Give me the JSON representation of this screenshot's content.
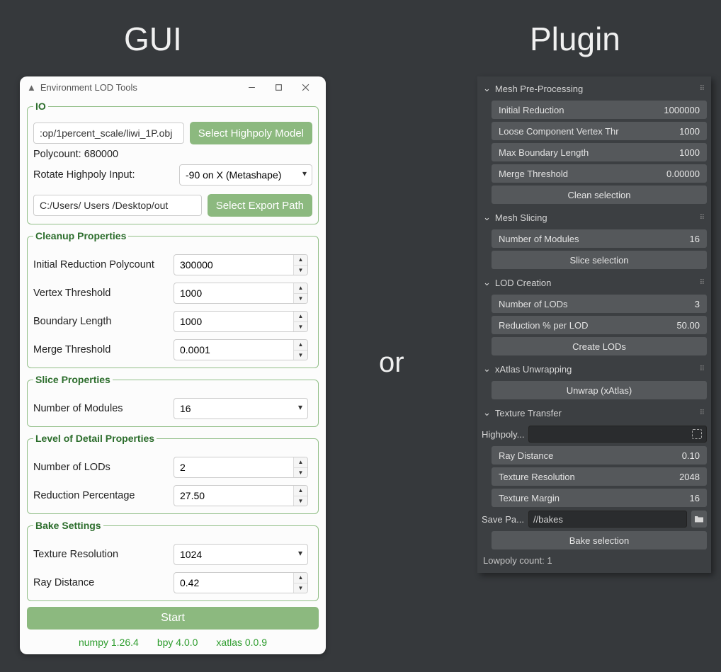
{
  "headings": {
    "gui": "GUI",
    "or": "or",
    "plugin": "Plugin"
  },
  "gui": {
    "title": "Environment LOD Tools",
    "io": {
      "legend": "IO",
      "highpoly_path": ":op/1percent_scale/liwi_1P.obj",
      "select_highpoly_btn": "Select Highpoly Model",
      "polycount_label": "Polycount: 680000",
      "rotate_label": "Rotate Highpoly Input:",
      "rotate_value": "-90 on X (Metashape)",
      "export_path": "C:/Users/ Users /Desktop/out",
      "select_export_btn": "Select Export Path"
    },
    "cleanup": {
      "legend": "Cleanup Properties",
      "initial_reduction_label": "Initial Reduction Polycount",
      "initial_reduction_value": "300000",
      "vertex_threshold_label": "Vertex Threshold",
      "vertex_threshold_value": "1000",
      "boundary_length_label": "Boundary Length",
      "boundary_length_value": "1000",
      "merge_threshold_label": "Merge Threshold",
      "merge_threshold_value": "0.0001"
    },
    "slice": {
      "legend": "Slice Properties",
      "modules_label": "Number of Modules",
      "modules_value": "16"
    },
    "lod": {
      "legend": "Level of Detail Properties",
      "num_lods_label": "Number of LODs",
      "num_lods_value": "2",
      "reduction_pct_label": "Reduction Percentage",
      "reduction_pct_value": "27.50"
    },
    "bake": {
      "legend": "Bake Settings",
      "tex_res_label": "Texture Resolution",
      "tex_res_value": "1024",
      "ray_dist_label": "Ray Distance",
      "ray_dist_value": "0.42"
    },
    "start_btn": "Start",
    "footer": {
      "numpy": "numpy 1.26.4",
      "bpy": "bpy 4.0.0",
      "xatlas": "xatlas 0.0.9"
    }
  },
  "plugin": {
    "mesh_pre": {
      "title": "Mesh Pre-Processing",
      "initial_reduction_label": "Initial Reduction",
      "initial_reduction_value": "1000000",
      "loose_comp_label": "Loose Component Vertex Thr",
      "loose_comp_value": "1000",
      "max_boundary_label": "Max Boundary Length",
      "max_boundary_value": "1000",
      "merge_threshold_label": "Merge Threshold",
      "merge_threshold_value": "0.00000",
      "clean_btn": "Clean selection"
    },
    "slicing": {
      "title": "Mesh Slicing",
      "num_modules_label": "Number of Modules",
      "num_modules_value": "16",
      "slice_btn": "Slice selection"
    },
    "lod": {
      "title": "LOD Creation",
      "num_lods_label": "Number of LODs",
      "num_lods_value": "3",
      "reduction_per_lod_label": "Reduction % per LOD",
      "reduction_per_lod_value": "50.00",
      "create_btn": "Create LODs"
    },
    "xatlas": {
      "title": "xAtlas Unwrapping",
      "unwrap_btn": "Unwrap (xAtlas)"
    },
    "tex": {
      "title": "Texture Transfer",
      "highpoly_label": "Highpoly...",
      "highpoly_value": "",
      "ray_dist_label": "Ray Distance",
      "ray_dist_value": "0.10",
      "tex_res_label": "Texture Resolution",
      "tex_res_value": "2048",
      "tex_margin_label": "Texture Margin",
      "tex_margin_value": "16",
      "save_path_label": "Save Pa...",
      "save_path_value": "//bakes",
      "bake_btn": "Bake selection"
    },
    "footer": "Lowpoly count: 1"
  }
}
